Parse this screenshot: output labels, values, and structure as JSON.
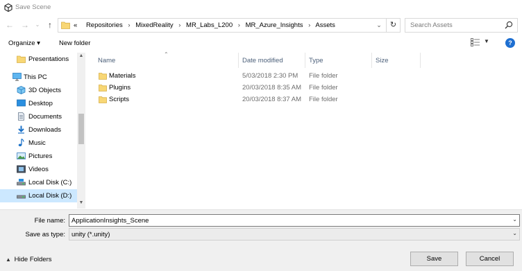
{
  "window": {
    "title": "Save Scene"
  },
  "nav": {
    "back_icon": "back-arrow-icon",
    "forward_icon": "forward-arrow-icon",
    "recent_icon": "chevron-down-icon",
    "up_icon": "up-arrow-icon"
  },
  "address": {
    "overflow": "«",
    "crumbs": [
      "Repositories",
      "MixedReality",
      "MR_Labs_L200",
      "MR_Azure_Insights",
      "Assets"
    ],
    "separator": "›"
  },
  "search": {
    "placeholder": "Search Assets"
  },
  "toolbar": {
    "organize_label": "Organize ▾",
    "new_folder_label": "New folder"
  },
  "sidebar": {
    "items": [
      {
        "label": "Presentations",
        "icon": "folder-icon",
        "indent": true
      },
      {
        "label": "This PC",
        "icon": "pc-icon",
        "indent": false
      },
      {
        "label": "3D Objects",
        "icon": "3d-objects-icon",
        "indent": true
      },
      {
        "label": "Desktop",
        "icon": "desktop-icon",
        "indent": true
      },
      {
        "label": "Documents",
        "icon": "documents-icon",
        "indent": true
      },
      {
        "label": "Downloads",
        "icon": "downloads-icon",
        "indent": true
      },
      {
        "label": "Music",
        "icon": "music-icon",
        "indent": true
      },
      {
        "label": "Pictures",
        "icon": "pictures-icon",
        "indent": true
      },
      {
        "label": "Videos",
        "icon": "videos-icon",
        "indent": true
      },
      {
        "label": "Local Disk (C:)",
        "icon": "drive-icon",
        "indent": true
      },
      {
        "label": "Local Disk (D:)",
        "icon": "drive-icon",
        "indent": true,
        "selected": true
      }
    ]
  },
  "files": {
    "columns": [
      "Name",
      "Date modified",
      "Type",
      "Size"
    ],
    "rows": [
      {
        "name": "Materials",
        "date": "5/03/2018 2:30 PM",
        "type": "File folder",
        "size": ""
      },
      {
        "name": "Plugins",
        "date": "20/03/2018 8:35 AM",
        "type": "File folder",
        "size": ""
      },
      {
        "name": "Scripts",
        "date": "20/03/2018 8:37 AM",
        "type": "File folder",
        "size": ""
      }
    ]
  },
  "form": {
    "file_name_label": "File name:",
    "file_name_value": "ApplicationInsights_Scene",
    "save_type_label": "Save as type:",
    "save_type_value": "unity (*.unity)"
  },
  "footer": {
    "hide_folders_label": "Hide Folders",
    "save_label": "Save",
    "cancel_label": "Cancel"
  },
  "colors": {
    "selection": "#cce8ff",
    "folder": "#f8d775",
    "accent": "#1e6fd1"
  }
}
